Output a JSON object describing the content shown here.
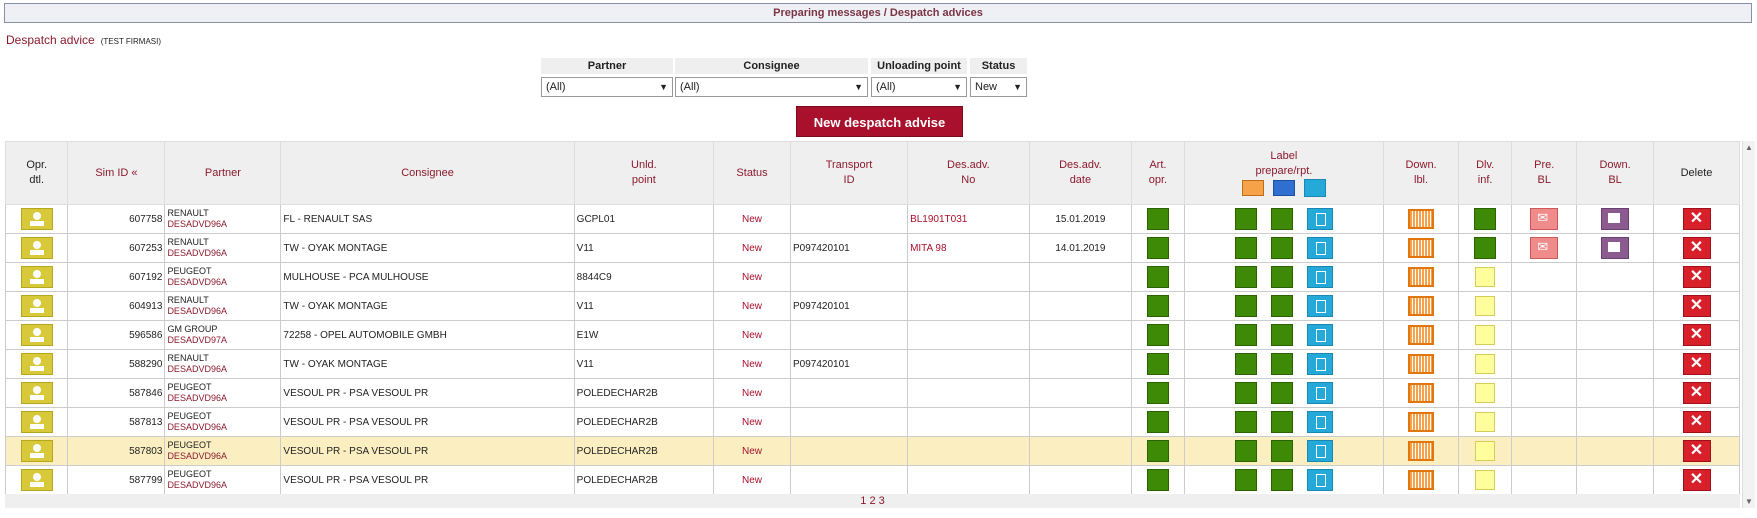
{
  "header": {
    "title": "Preparing messages / Despatch advices"
  },
  "subtitle": {
    "text": "Despatch advice",
    "company": "(TEST FIRMASI)"
  },
  "filters": {
    "partner": {
      "label": "Partner",
      "value": "(All)"
    },
    "consignee": {
      "label": "Consignee",
      "value": "(All)"
    },
    "unloading": {
      "label": "Unloading point",
      "value": "(All)"
    },
    "status": {
      "label": "Status",
      "value": "New"
    }
  },
  "new_button": "New despatch advise",
  "columns": {
    "opr_dtl_1": "Opr.",
    "opr_dtl_2": "dtl.",
    "sim_id": "Sim ID «",
    "partner": "Partner",
    "consignee": "Consignee",
    "unld_1": "Unld.",
    "unld_2": "point",
    "status": "Status",
    "transport_1": "Transport",
    "transport_2": "ID",
    "desadv_1": "Des.adv.",
    "desadv_2": "No",
    "desdate_1": "Des.adv.",
    "desdate_2": "date",
    "art_1": "Art.",
    "art_2": "opr.",
    "label_1": "Label",
    "label_2": "prepare/rpt.",
    "down_lbl_1": "Down.",
    "down_lbl_2": "lbl.",
    "dlv_1": "Dlv.",
    "dlv_2": "inf.",
    "pre_bl_1": "Pre.",
    "pre_bl_2": "BL",
    "down_bl_1": "Down.",
    "down_bl_2": "BL",
    "delete": "Delete"
  },
  "rows": [
    {
      "id": "607758",
      "partner": "RENAULT",
      "partner_code": "DESADVD96A",
      "consignee": "FL - RENAULT SAS",
      "unld": "GCPL01",
      "status": "New",
      "transport": "",
      "desadv_no": "BL1901T031",
      "date": "15.01.2019",
      "dlv_green": true,
      "bl": true,
      "highlight": false
    },
    {
      "id": "607253",
      "partner": "RENAULT",
      "partner_code": "DESADVD96A",
      "consignee": "TW - OYAK MONTAGE",
      "unld": "V11",
      "status": "New",
      "transport": "P097420101",
      "desadv_no": "MITA 98",
      "date": "14.01.2019",
      "dlv_green": true,
      "bl": true,
      "highlight": false
    },
    {
      "id": "607192",
      "partner": "PEUGEOT",
      "partner_code": "DESADVD96A",
      "consignee": "MULHOUSE - PCA MULHOUSE",
      "unld": "8844C9",
      "status": "New",
      "transport": "",
      "desadv_no": "",
      "date": "",
      "dlv_green": false,
      "bl": false,
      "highlight": false
    },
    {
      "id": "604913",
      "partner": "RENAULT",
      "partner_code": "DESADVD96A",
      "consignee": "TW - OYAK MONTAGE",
      "unld": "V11",
      "status": "New",
      "transport": "P097420101",
      "desadv_no": "",
      "date": "",
      "dlv_green": false,
      "bl": false,
      "highlight": false
    },
    {
      "id": "596586",
      "partner": "GM GROUP",
      "partner_code": "DESADVD97A",
      "consignee": "72258 - OPEL AUTOMOBILE GMBH",
      "unld": "E1W",
      "status": "New",
      "transport": "",
      "desadv_no": "",
      "date": "",
      "dlv_green": false,
      "bl": false,
      "highlight": false
    },
    {
      "id": "588290",
      "partner": "RENAULT",
      "partner_code": "DESADVD96A",
      "consignee": "TW - OYAK MONTAGE",
      "unld": "V11",
      "status": "New",
      "transport": "P097420101",
      "desadv_no": "",
      "date": "",
      "dlv_green": false,
      "bl": false,
      "highlight": false
    },
    {
      "id": "587846",
      "partner": "PEUGEOT",
      "partner_code": "DESADVD96A",
      "consignee": "VESOUL PR - PSA VESOUL PR",
      "unld": "POLEDECHAR2B",
      "status": "New",
      "transport": "",
      "desadv_no": "",
      "date": "",
      "dlv_green": false,
      "bl": false,
      "highlight": false
    },
    {
      "id": "587813",
      "partner": "PEUGEOT",
      "partner_code": "DESADVD96A",
      "consignee": "VESOUL PR - PSA VESOUL PR",
      "unld": "POLEDECHAR2B",
      "status": "New",
      "transport": "",
      "desadv_no": "",
      "date": "",
      "dlv_green": false,
      "bl": false,
      "highlight": false
    },
    {
      "id": "587803",
      "partner": "PEUGEOT",
      "partner_code": "DESADVD96A",
      "consignee": "VESOUL PR - PSA VESOUL PR",
      "unld": "POLEDECHAR2B",
      "status": "New",
      "transport": "",
      "desadv_no": "",
      "date": "",
      "dlv_green": false,
      "bl": false,
      "highlight": true
    },
    {
      "id": "587799",
      "partner": "PEUGEOT",
      "partner_code": "DESADVD96A",
      "consignee": "VESOUL PR - PSA VESOUL PR",
      "unld": "POLEDECHAR2B",
      "status": "New",
      "transport": "",
      "desadv_no": "",
      "date": "",
      "dlv_green": false,
      "bl": false,
      "highlight": false
    }
  ],
  "pager": [
    "1",
    "2",
    "3"
  ]
}
